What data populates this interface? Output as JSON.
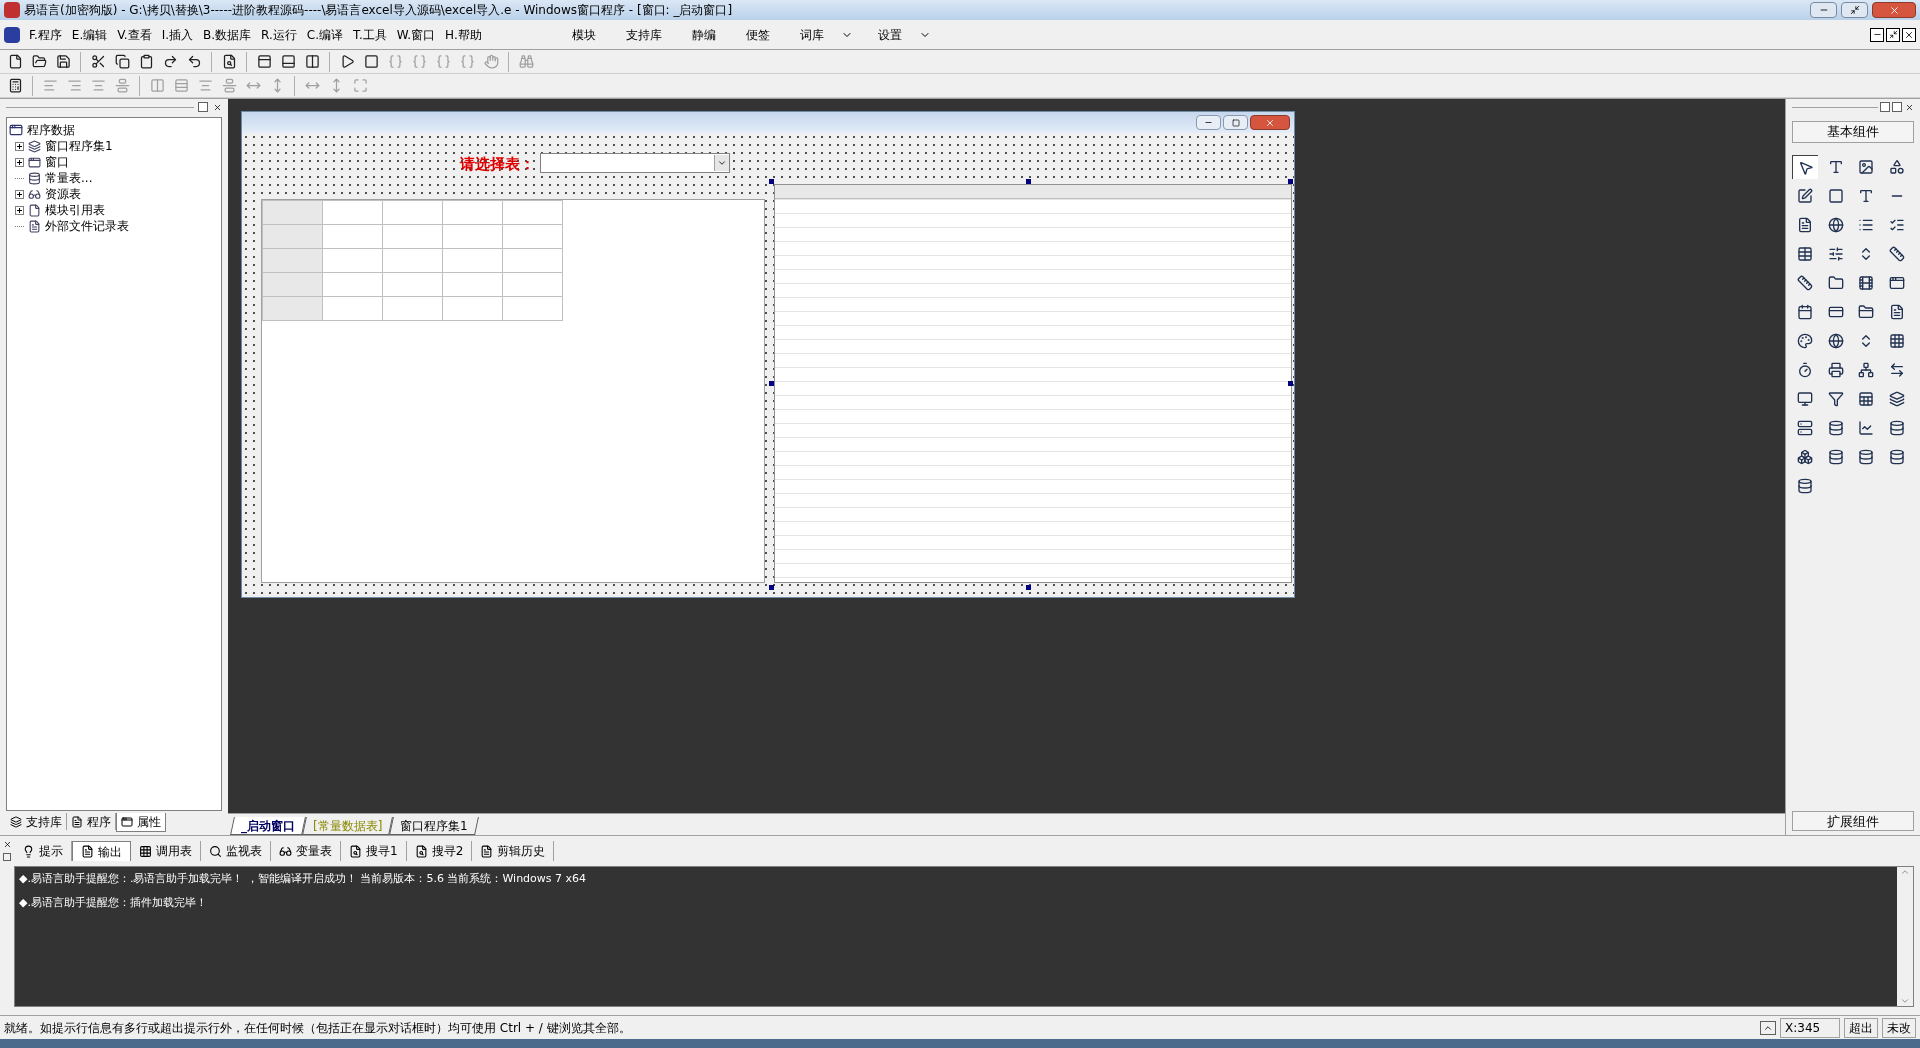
{
  "window": {
    "title": "易语言(加密狗版) - G:\\拷贝\\替换\\3-----进阶教程源码----\\易语言excel导入源码\\excel导入.e - Windows窗口程序 - [窗口: _启动窗口]"
  },
  "menu": [
    "F.程序",
    "E.编辑",
    "V.查看",
    "I.插入",
    "B.数据库",
    "R.运行",
    "C.编译",
    "T.工具",
    "W.窗口",
    "H.帮助"
  ],
  "menu_right": [
    {
      "label": "模块",
      "kind": "plain"
    },
    {
      "label": "支持库",
      "kind": "plain"
    },
    {
      "label": "静编",
      "kind": "plain"
    },
    {
      "label": "便签",
      "kind": "plain"
    },
    {
      "label": "词库",
      "kind": "dropdown"
    },
    {
      "label": "设置",
      "kind": "dropdown"
    }
  ],
  "tree": {
    "label": "程序数据",
    "children": [
      {
        "label": "窗口程序集1",
        "kind": "expandable",
        "expanded": false
      },
      {
        "label": "窗口",
        "kind": "expandable",
        "expanded": false
      },
      {
        "label": "常量表...",
        "kind": "leaf"
      },
      {
        "label": "资源表",
        "kind": "expandable",
        "expanded": false
      },
      {
        "label": "模块引用表",
        "kind": "expandable",
        "expanded": false
      },
      {
        "label": "外部文件记录表",
        "kind": "leaf"
      }
    ]
  },
  "left_tabs": [
    {
      "label": "支持库",
      "selected": false
    },
    {
      "label": "程序",
      "selected": false
    },
    {
      "label": "属性",
      "selected": true
    }
  ],
  "designer": {
    "label": "请选择表："
  },
  "editor_tabs": [
    {
      "label": "_启动窗口",
      "selected": true,
      "kind": "window"
    },
    {
      "label": "[常量数据表]",
      "selected": false,
      "kind": "constants"
    },
    {
      "label": "窗口程序集1",
      "selected": false,
      "kind": "code"
    }
  ],
  "toolbox": {
    "header": "基本组件",
    "footer": "扩展组件",
    "tools": [
      {
        "selected": true
      },
      {
        "selected": false
      },
      {
        "selected": false
      },
      {
        "selected": false
      },
      {
        "selected": false
      },
      {
        "selected": false
      },
      {
        "selected": false
      },
      {
        "selected": false
      },
      {
        "selected": false
      },
      {
        "selected": false
      },
      {
        "selected": false
      },
      {
        "selected": false
      },
      {
        "selected": false
      },
      {
        "selected": false
      },
      {
        "selected": false
      },
      {
        "selected": false
      },
      {
        "selected": false
      },
      {
        "selected": false
      },
      {
        "selected": false
      },
      {
        "selected": false
      },
      {
        "selected": false
      },
      {
        "selected": false
      },
      {
        "selected": false
      },
      {
        "selected": false
      },
      {
        "selected": false
      },
      {
        "selected": false
      },
      {
        "selected": false
      },
      {
        "selected": false
      },
      {
        "selected": false
      },
      {
        "selected": false
      },
      {
        "selected": false
      },
      {
        "selected": false
      },
      {
        "selected": false
      },
      {
        "selected": false
      },
      {
        "selected": false
      },
      {
        "selected": false
      },
      {
        "selected": false
      },
      {
        "selected": false
      },
      {
        "selected": false
      },
      {
        "selected": false
      },
      {
        "selected": false
      },
      {
        "selected": false
      },
      {
        "selected": false
      },
      {
        "selected": false
      },
      {
        "selected": false
      }
    ]
  },
  "output_tabs": [
    {
      "label": "提示",
      "selected": false
    },
    {
      "label": "输出",
      "selected": true
    },
    {
      "label": "调用表",
      "selected": false
    },
    {
      "label": "监视表",
      "selected": false
    },
    {
      "label": "变量表",
      "selected": false
    },
    {
      "label": "搜寻1",
      "selected": false
    },
    {
      "label": "搜寻2",
      "selected": false
    },
    {
      "label": "剪辑历史",
      "selected": false
    }
  ],
  "output_lines": [
    "◆.易语言助手提醒您：.易语言助手加载完毕！ ，智能编译开启成功！ 当前易版本：5.6  当前系统：Windows 7 x64",
    "◆.易语言助手提醒您：插件加载完毕！"
  ],
  "status_bar": {
    "message": "就绪。如提示行信息有多行或超出提示行外，在任何时候（包括正在显示对话框时）均可使用 Ctrl + / 键浏览其全部。",
    "position": "X:345",
    "mode": "超出",
    "modified": "未改"
  }
}
